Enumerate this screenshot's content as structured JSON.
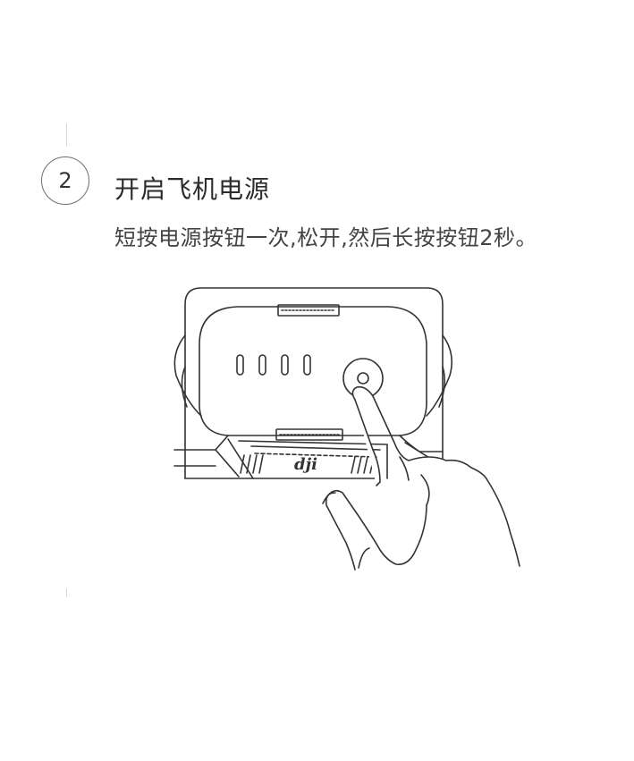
{
  "step": {
    "number": "2",
    "title": "开启飞机电源",
    "description": "短按电源按钮一次,松开,然后长按按钮2秒。"
  },
  "illustration": {
    "logo_text": "dji",
    "icons": [
      "battery-level-indicator-icon",
      "power-button-icon",
      "finger-press-icon"
    ]
  },
  "colors": {
    "line": "#333333",
    "guide": "#d6d6d6"
  }
}
